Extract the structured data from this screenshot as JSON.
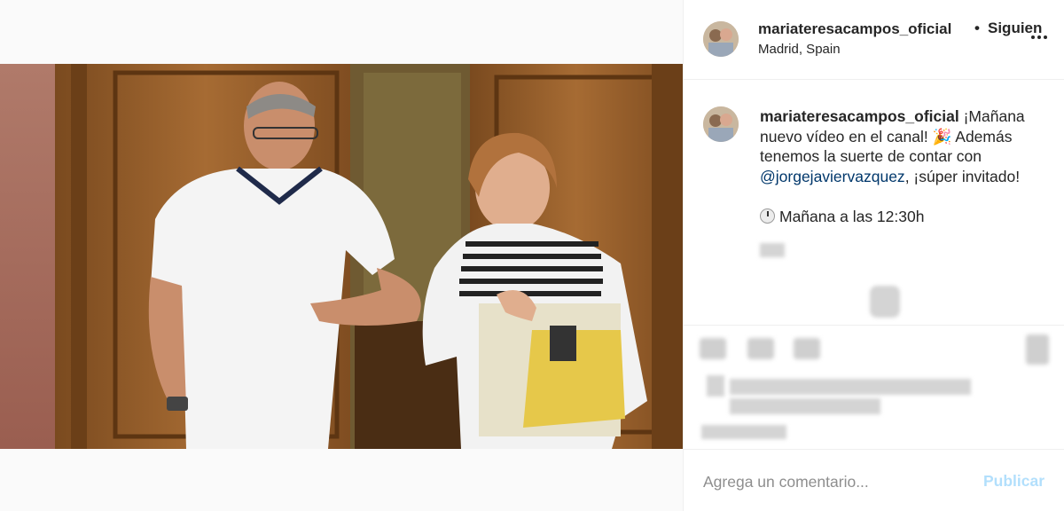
{
  "header": {
    "username": "mariateresacampos_oficial",
    "separator": "•",
    "follow_label": "Siguien",
    "location": "Madrid, Spain",
    "more_icon": "more-options-icon"
  },
  "caption": {
    "username": "mariateresacampos_oficial",
    "text_part1": "¡Mañana nuevo vídeo en el canal! 🎉 Además tenemos la suerte de contar con ",
    "mention": "@jorgejaviervazquez",
    "text_part2": ", ¡súper invitado!",
    "time_line": "Mañana a las 12:30h",
    "clock_icon": "clock-icon"
  },
  "comment": {
    "placeholder": "Agrega un comentario...",
    "publish_label": "Publicar"
  },
  "colors": {
    "mention": "#00376b",
    "publish_disabled": "#b2dffc",
    "text": "#262626",
    "muted": "#8e8e8e"
  }
}
